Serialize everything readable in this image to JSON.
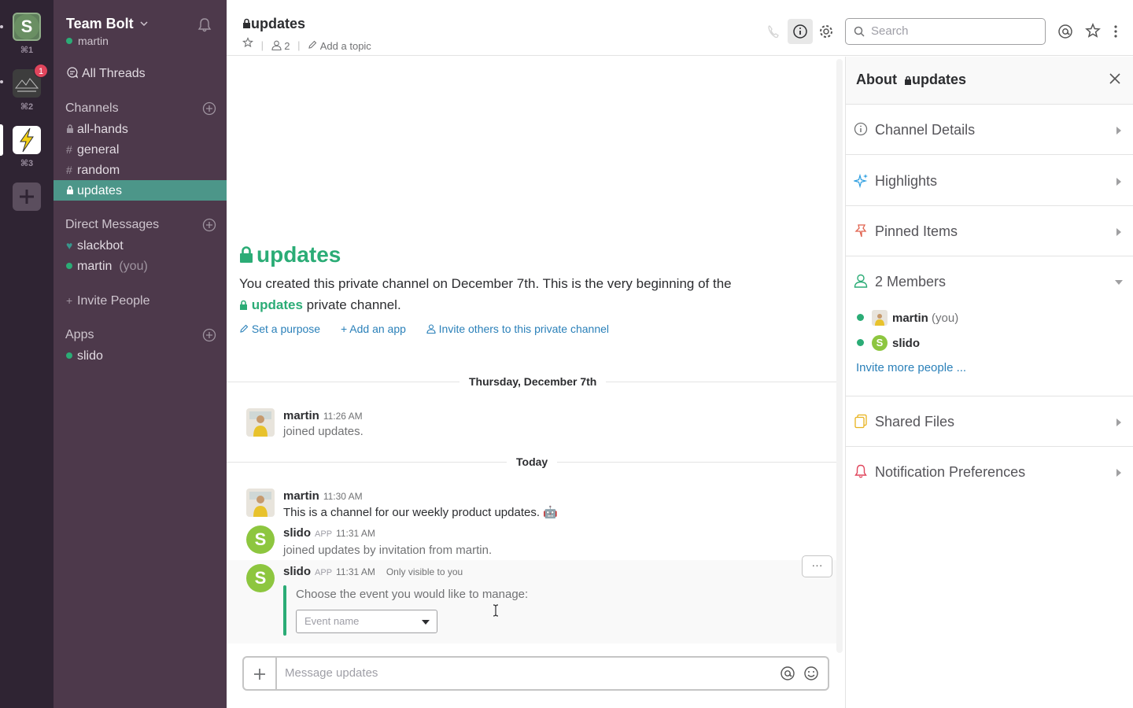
{
  "workspaces": [
    {
      "shortcut": "⌘1",
      "name": "S"
    },
    {
      "shortcut": "⌘2",
      "badge": "1"
    },
    {
      "shortcut": "⌘3"
    }
  ],
  "sidebar": {
    "team_name": "Team Bolt",
    "user": "martin",
    "all_threads": "All Threads",
    "channels_heading": "Channels",
    "channels": [
      {
        "name": "all-hands",
        "private": true
      },
      {
        "name": "general",
        "private": false
      },
      {
        "name": "random",
        "private": false
      },
      {
        "name": "updates",
        "private": true,
        "active": true
      }
    ],
    "dm_heading": "Direct Messages",
    "dms": [
      {
        "name": "slackbot"
      },
      {
        "name": "martin",
        "suffix": "(you)"
      }
    ],
    "invite_people": "Invite People",
    "apps_heading": "Apps",
    "apps": [
      {
        "name": "slido"
      }
    ]
  },
  "header": {
    "channel": "updates",
    "member_count": "2",
    "add_topic": "Add a topic",
    "search_placeholder": "Search"
  },
  "intro": {
    "title": "updates",
    "text_before": "You created this private channel on December 7th. This is the very beginning of the",
    "channel": "updates",
    "text_after": "private channel.",
    "set_purpose": "Set a purpose",
    "add_app": "Add an app",
    "invite_others": "Invite others to this private channel"
  },
  "dividers": [
    "Thursday, December 7th",
    "Today"
  ],
  "messages": [
    {
      "author": "martin",
      "time": "11:26 AM",
      "text": "joined updates."
    },
    {
      "author": "martin",
      "time": "11:30 AM",
      "text": "This is a channel for our weekly product updates. 🤖"
    },
    {
      "author": "slido",
      "app": "APP",
      "time": "11:31 AM",
      "text": "joined updates by invitation from martin."
    },
    {
      "author": "slido",
      "app": "APP",
      "time": "11:31 AM",
      "visibility": "Only visible to you",
      "text": "Choose the event you would like to manage:",
      "select_placeholder": "Event name",
      "more": "···"
    }
  ],
  "composer": {
    "placeholder": "Message updates"
  },
  "panel": {
    "title_prefix": "About",
    "channel": "updates",
    "sections": {
      "channel_details": "Channel Details",
      "highlights": "Highlights",
      "pinned_items": "Pinned Items",
      "members": "2 Members",
      "shared_files": "Shared Files",
      "notification_prefs": "Notification Preferences"
    },
    "members": [
      {
        "name": "martin",
        "suffix": "(you)"
      },
      {
        "name": "slido"
      }
    ],
    "invite_more": "Invite more people ..."
  },
  "colors": {
    "sidebar_bg": "#4d394b",
    "rail_bg": "#2f2433",
    "active_channel": "#4c9689",
    "accent_green": "#2bac76",
    "link_blue": "#2a80b9"
  }
}
